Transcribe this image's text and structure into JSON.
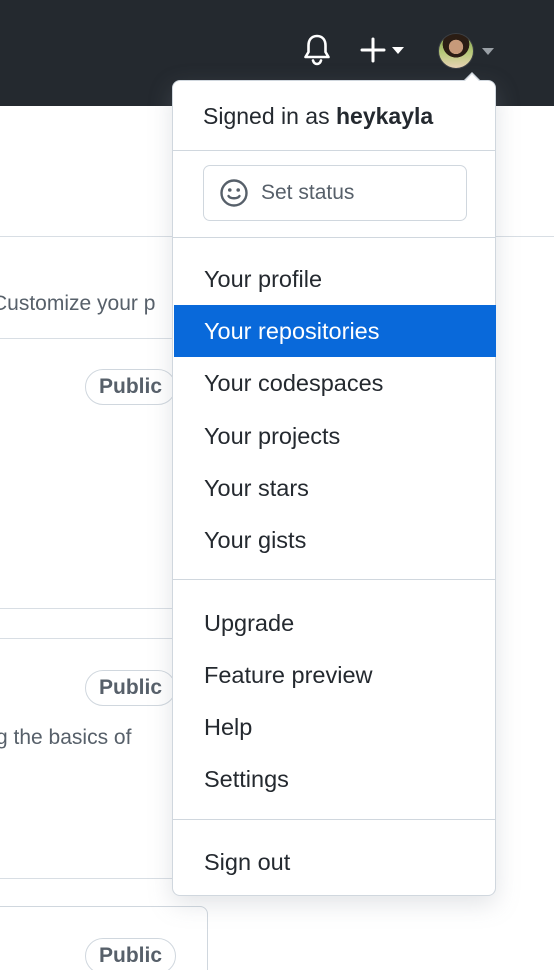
{
  "header": {
    "bell_icon": "bell-icon",
    "create_icon": "plus-icon",
    "avatar_alt": "heykayla avatar"
  },
  "background": {
    "customize_text": "Customize your p",
    "public_label": "Public",
    "basics_text": "g the basics of"
  },
  "dropdown": {
    "signed_in_prefix": "Signed in as",
    "username": "heykayla",
    "set_status_label": "Set status",
    "section_user": [
      {
        "label": "Your profile",
        "active": false
      },
      {
        "label": "Your repositories",
        "active": true
      },
      {
        "label": "Your codespaces",
        "active": false
      },
      {
        "label": "Your projects",
        "active": false
      },
      {
        "label": "Your stars",
        "active": false
      },
      {
        "label": "Your gists",
        "active": false
      }
    ],
    "section_help": [
      {
        "label": "Upgrade"
      },
      {
        "label": "Feature preview"
      },
      {
        "label": "Help"
      },
      {
        "label": "Settings"
      }
    ],
    "sign_out_label": "Sign out"
  },
  "colors": {
    "header_bg": "#24292f",
    "active_bg": "#0969da",
    "border": "#d0d7de"
  }
}
